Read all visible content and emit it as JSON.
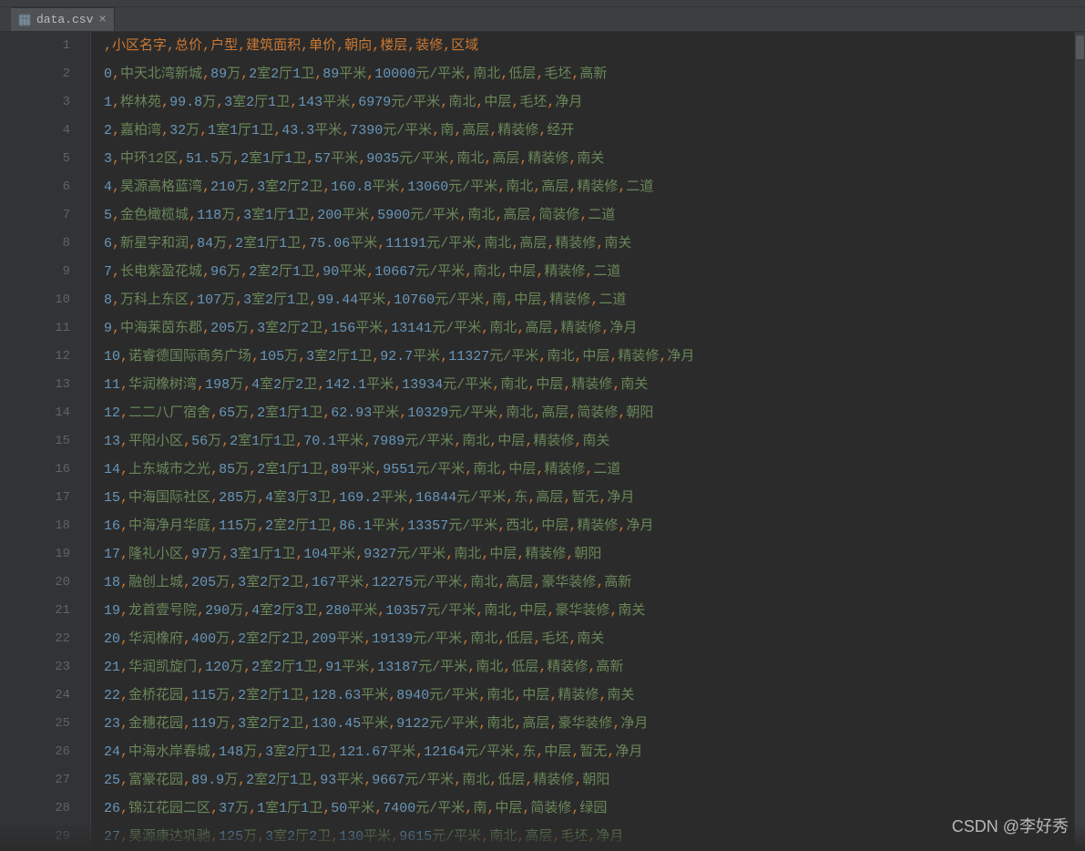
{
  "tab": {
    "filename": "data.csv",
    "icon": "csv-icon"
  },
  "watermark": "CSDN @李好秀",
  "header": [
    "",
    "小区名字",
    "总价",
    "户型",
    "建筑面积",
    "单价",
    "朝向",
    "楼层",
    "装修",
    "区域"
  ],
  "rows": [
    [
      "0",
      "中天北湾新城",
      "89万",
      "2室2厅1卫",
      "89平米",
      "10000元/平米",
      "南北",
      "低层",
      "毛坯",
      "高新"
    ],
    [
      "1",
      "桦林苑",
      "99.8万",
      "3室2厅1卫",
      "143平米",
      "6979元/平米",
      "南北",
      "中层",
      "毛坯",
      "净月"
    ],
    [
      "2",
      "嘉柏湾",
      "32万",
      "1室1厅1卫",
      "43.3平米",
      "7390元/平米",
      "南",
      "高层",
      "精装修",
      "经开"
    ],
    [
      "3",
      "中环12区",
      "51.5万",
      "2室1厅1卫",
      "57平米",
      "9035元/平米",
      "南北",
      "高层",
      "精装修",
      "南关"
    ],
    [
      "4",
      "昊源高格蓝湾",
      "210万",
      "3室2厅2卫",
      "160.8平米",
      "13060元/平米",
      "南北",
      "高层",
      "精装修",
      "二道"
    ],
    [
      "5",
      "金色橄榄城",
      "118万",
      "3室1厅1卫",
      "200平米",
      "5900元/平米",
      "南北",
      "高层",
      "简装修",
      "二道"
    ],
    [
      "6",
      "新星宇和润",
      "84万",
      "2室1厅1卫",
      "75.06平米",
      "11191元/平米",
      "南北",
      "高层",
      "精装修",
      "南关"
    ],
    [
      "7",
      "长电紫盈花城",
      "96万",
      "2室2厅1卫",
      "90平米",
      "10667元/平米",
      "南北",
      "中层",
      "精装修",
      "二道"
    ],
    [
      "8",
      "万科上东区",
      "107万",
      "3室2厅1卫",
      "99.44平米",
      "10760元/平米",
      "南",
      "中层",
      "精装修",
      "二道"
    ],
    [
      "9",
      "中海莱茵东郡",
      "205万",
      "3室2厅2卫",
      "156平米",
      "13141元/平米",
      "南北",
      "高层",
      "精装修",
      "净月"
    ],
    [
      "10",
      "诺睿德国际商务广场",
      "105万",
      "3室2厅1卫",
      "92.7平米",
      "11327元/平米",
      "南北",
      "中层",
      "精装修",
      "净月"
    ],
    [
      "11",
      "华润橡树湾",
      "198万",
      "4室2厅2卫",
      "142.1平米",
      "13934元/平米",
      "南北",
      "中层",
      "精装修",
      "南关"
    ],
    [
      "12",
      "二二八厂宿舍",
      "65万",
      "2室1厅1卫",
      "62.93平米",
      "10329元/平米",
      "南北",
      "高层",
      "简装修",
      "朝阳"
    ],
    [
      "13",
      "平阳小区",
      "56万",
      "2室1厅1卫",
      "70.1平米",
      "7989元/平米",
      "南北",
      "中层",
      "精装修",
      "南关"
    ],
    [
      "14",
      "上东城市之光",
      "85万",
      "2室1厅1卫",
      "89平米",
      "9551元/平米",
      "南北",
      "中层",
      "精装修",
      "二道"
    ],
    [
      "15",
      "中海国际社区",
      "285万",
      "4室3厅3卫",
      "169.2平米",
      "16844元/平米",
      "东",
      "高层",
      "暂无",
      "净月"
    ],
    [
      "16",
      "中海净月华庭",
      "115万",
      "2室2厅1卫",
      "86.1平米",
      "13357元/平米",
      "西北",
      "中层",
      "精装修",
      "净月"
    ],
    [
      "17",
      "隆礼小区",
      "97万",
      "3室1厅1卫",
      "104平米",
      "9327元/平米",
      "南北",
      "中层",
      "精装修",
      "朝阳"
    ],
    [
      "18",
      "融创上城",
      "205万",
      "3室2厅2卫",
      "167平米",
      "12275元/平米",
      "南北",
      "高层",
      "豪华装修",
      "高新"
    ],
    [
      "19",
      "龙首壹号院",
      "290万",
      "4室2厅3卫",
      "280平米",
      "10357元/平米",
      "南北",
      "中层",
      "豪华装修",
      "南关"
    ],
    [
      "20",
      "华润橡府",
      "400万",
      "2室2厅2卫",
      "209平米",
      "19139元/平米",
      "南北",
      "低层",
      "毛坯",
      "南关"
    ],
    [
      "21",
      "华润凯旋门",
      "120万",
      "2室2厅1卫",
      "91平米",
      "13187元/平米",
      "南北",
      "低层",
      "精装修",
      "高新"
    ],
    [
      "22",
      "金桥花园",
      "115万",
      "2室2厅1卫",
      "128.63平米",
      "8940元/平米",
      "南北",
      "中层",
      "精装修",
      "南关"
    ],
    [
      "23",
      "金穗花园",
      "119万",
      "3室2厅2卫",
      "130.45平米",
      "9122元/平米",
      "南北",
      "高层",
      "豪华装修",
      "净月"
    ],
    [
      "24",
      "中海水岸春城",
      "148万",
      "3室2厅1卫",
      "121.67平米",
      "12164元/平米",
      "东",
      "中层",
      "暂无",
      "净月"
    ],
    [
      "25",
      "富豪花园",
      "89.9万",
      "2室2厅1卫",
      "93平米",
      "9667元/平米",
      "南北",
      "低层",
      "精装修",
      "朝阳"
    ],
    [
      "26",
      "锦江花园二区",
      "37万",
      "1室1厅1卫",
      "50平米",
      "7400元/平米",
      "南",
      "中层",
      "简装修",
      "绿园"
    ],
    [
      "27",
      "昊源康达巩驰",
      "125万",
      "3室2厅2卫",
      "130平米",
      "9615元/平米",
      "南北",
      "高层",
      "毛坯",
      "净月"
    ]
  ],
  "line_count": 29
}
